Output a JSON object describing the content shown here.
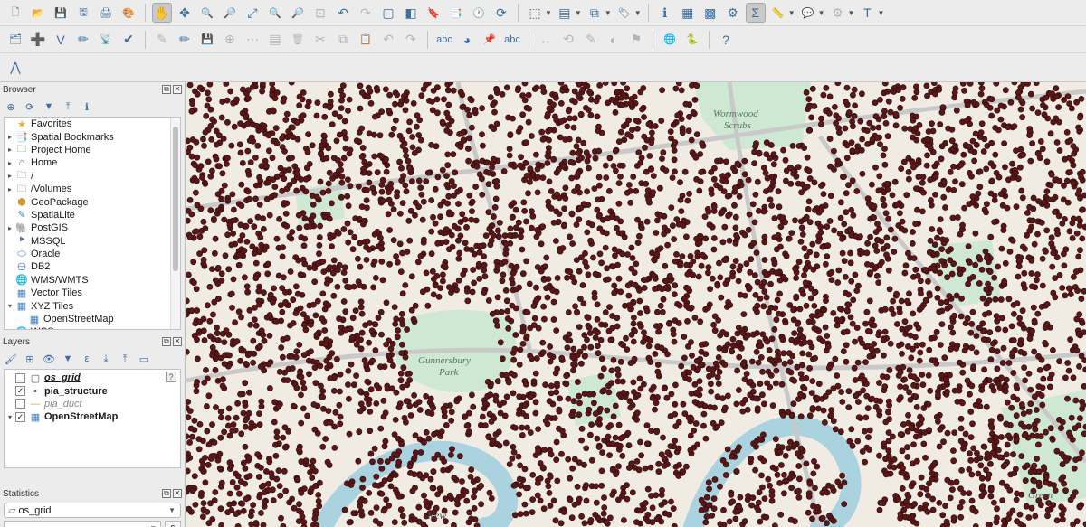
{
  "toolbar_row1": [
    {
      "icon": "new-project-icon",
      "glyph": "🗋"
    },
    {
      "icon": "open-project-icon",
      "glyph": "📂"
    },
    {
      "icon": "save-project-icon",
      "glyph": "💾"
    },
    {
      "icon": "save-as-icon",
      "glyph": "🖫"
    },
    {
      "icon": "print-layout-icon",
      "glyph": "🖨"
    },
    {
      "icon": "style-manager-icon",
      "glyph": "🎨"
    },
    {
      "icon": "pan-map-icon",
      "glyph": "✋",
      "active": true
    },
    {
      "icon": "pan-to-selection-icon",
      "glyph": "✥"
    },
    {
      "icon": "zoom-in-icon",
      "glyph": "🔍"
    },
    {
      "icon": "zoom-out-icon",
      "glyph": "🔎"
    },
    {
      "icon": "zoom-full-icon",
      "glyph": "⤢"
    },
    {
      "icon": "zoom-selection-icon",
      "glyph": "🔍"
    },
    {
      "icon": "zoom-layer-icon",
      "glyph": "🔎"
    },
    {
      "icon": "zoom-native-icon",
      "glyph": "⊡",
      "disabled": true
    },
    {
      "icon": "zoom-last-icon",
      "glyph": "↶"
    },
    {
      "icon": "zoom-next-icon",
      "glyph": "↷",
      "disabled": true
    },
    {
      "icon": "new-map-view-icon",
      "glyph": "▢"
    },
    {
      "icon": "new-3d-view-icon",
      "glyph": "◧"
    },
    {
      "icon": "spatial-bookmark-icon",
      "glyph": "🔖"
    },
    {
      "icon": "show-bookmarks-icon",
      "glyph": "📑"
    },
    {
      "icon": "temporal-controller-icon",
      "glyph": "🕐"
    },
    {
      "icon": "refresh-icon",
      "glyph": "⟳"
    },
    {
      "icon": "select-features-icon",
      "glyph": "⬚",
      "caret": true
    },
    {
      "icon": "select-by-value-icon",
      "glyph": "▤",
      "caret": true
    },
    {
      "icon": "deselect-icon",
      "glyph": "⧉",
      "caret": true
    },
    {
      "icon": "label-icon",
      "glyph": "🏷",
      "caret": true
    },
    {
      "icon": "identify-icon",
      "glyph": "ℹ"
    },
    {
      "icon": "attribute-table-icon",
      "glyph": "▦"
    },
    {
      "icon": "field-calculator-icon",
      "glyph": "▩"
    },
    {
      "icon": "settings-gear-icon",
      "glyph": "⚙"
    },
    {
      "icon": "statistics-sigma-icon",
      "glyph": "Σ",
      "active": true
    },
    {
      "icon": "measure-icon",
      "glyph": "📏",
      "caret": true
    },
    {
      "icon": "map-tips-icon",
      "glyph": "💬",
      "caret": true
    },
    {
      "icon": "locator-icon",
      "glyph": "⚙",
      "caret": true,
      "disabled": true
    },
    {
      "icon": "text-annotation-icon",
      "glyph": "T",
      "caret": true
    }
  ],
  "toolbar_row2": [
    {
      "icon": "data-source-manager-icon",
      "glyph": "🗂"
    },
    {
      "icon": "new-layer-icon",
      "glyph": "➕"
    },
    {
      "icon": "add-vector-icon",
      "glyph": "V"
    },
    {
      "icon": "digitize-icon",
      "glyph": "✏"
    },
    {
      "icon": "gps-icon",
      "glyph": "📡"
    },
    {
      "icon": "validate-icon",
      "glyph": "✔"
    },
    {
      "icon": "current-edits-icon",
      "glyph": "✎",
      "disabled": true
    },
    {
      "icon": "toggle-editing-icon",
      "glyph": "✏"
    },
    {
      "icon": "save-edits-icon",
      "glyph": "💾",
      "disabled": true
    },
    {
      "icon": "add-feature-icon",
      "glyph": "⊕",
      "disabled": true
    },
    {
      "icon": "vertex-tool-icon",
      "glyph": "⋯",
      "disabled": true
    },
    {
      "icon": "modify-attributes-icon",
      "glyph": "▤",
      "disabled": true
    },
    {
      "icon": "delete-selected-icon",
      "glyph": "🗑",
      "disabled": true
    },
    {
      "icon": "cut-features-icon",
      "glyph": "✂",
      "disabled": true
    },
    {
      "icon": "copy-features-icon",
      "glyph": "⧉",
      "disabled": true
    },
    {
      "icon": "paste-features-icon",
      "glyph": "📋",
      "disabled": true
    },
    {
      "icon": "undo-icon",
      "glyph": "↶",
      "disabled": true
    },
    {
      "icon": "redo-icon",
      "glyph": "↷",
      "disabled": true
    },
    {
      "icon": "label-toolbar-icon",
      "glyph": "abc"
    },
    {
      "icon": "diagram-icon",
      "glyph": "◕"
    },
    {
      "icon": "pin-label-icon",
      "glyph": "📌"
    },
    {
      "icon": "highlight-label-icon",
      "glyph": "abc"
    },
    {
      "icon": "move-label-icon",
      "glyph": "↔",
      "disabled": true
    },
    {
      "icon": "rotate-label-icon",
      "glyph": "⟲",
      "disabled": true
    },
    {
      "icon": "change-label-icon",
      "glyph": "✎",
      "disabled": true
    },
    {
      "icon": "show-hide-label-icon",
      "glyph": "◐",
      "disabled": true
    },
    {
      "icon": "label-props-icon",
      "glyph": "⚑",
      "disabled": true
    },
    {
      "icon": "plugin-icon",
      "glyph": "🌐"
    },
    {
      "icon": "python-console-icon",
      "glyph": "🐍"
    },
    {
      "icon": "help-book-icon",
      "glyph": "?"
    }
  ],
  "toolbar_row3": [
    {
      "icon": "plugin-logo-icon",
      "glyph": "⋀"
    }
  ],
  "browser": {
    "title": "Browser",
    "toolbar": [
      {
        "icon": "add-selected-layers-icon",
        "glyph": "⊕"
      },
      {
        "icon": "refresh-browser-icon",
        "glyph": "⟳"
      },
      {
        "icon": "filter-browser-icon",
        "glyph": "▼"
      },
      {
        "icon": "collapse-all-icon",
        "glyph": "⤒"
      },
      {
        "icon": "enable-properties-icon",
        "glyph": "ℹ"
      }
    ],
    "items": [
      {
        "label": "Favorites",
        "icon": "star-icon",
        "glyph": "★",
        "color": "#e3b23c",
        "arrow": "",
        "indent": 0
      },
      {
        "label": "Spatial Bookmarks",
        "icon": "bookmarks-icon",
        "glyph": "📑",
        "color": "#6b8eb5",
        "arrow": "▸",
        "indent": 0
      },
      {
        "label": "Project Home",
        "icon": "project-home-icon",
        "glyph": "🗀",
        "color": "#4f8f3a",
        "arrow": "▸",
        "indent": 0
      },
      {
        "label": "Home",
        "icon": "home-icon",
        "glyph": "⌂",
        "color": "#555555",
        "arrow": "▸",
        "indent": 0
      },
      {
        "label": "/",
        "icon": "folder-icon",
        "glyph": "🗀",
        "color": "#7a7a7a",
        "arrow": "▸",
        "indent": 0
      },
      {
        "label": "/Volumes",
        "icon": "folder-icon",
        "glyph": "🗀",
        "color": "#7a7a7a",
        "arrow": "▸",
        "indent": 0
      },
      {
        "label": "GeoPackage",
        "icon": "geopackage-icon",
        "glyph": "⬢",
        "color": "#d39a2c",
        "arrow": "",
        "indent": 0
      },
      {
        "label": "SpatiaLite",
        "icon": "spatialite-icon",
        "glyph": "✎",
        "color": "#3d7fc2",
        "arrow": "",
        "indent": 0
      },
      {
        "label": "PostGIS",
        "icon": "postgis-elephant-icon",
        "glyph": "🐘",
        "color": "#336791",
        "arrow": "▸",
        "indent": 0
      },
      {
        "label": "MSSQL",
        "icon": "mssql-icon",
        "glyph": "⯈",
        "color": "#5a6f9a",
        "arrow": "",
        "indent": 0
      },
      {
        "label": "Oracle",
        "icon": "oracle-icon",
        "glyph": "⬭",
        "color": "#3b6fb5",
        "arrow": "",
        "indent": 0
      },
      {
        "label": "DB2",
        "icon": "db2-icon",
        "glyph": "⛁",
        "color": "#3b6fb5",
        "arrow": "",
        "indent": 0
      },
      {
        "label": "WMS/WMTS",
        "icon": "wms-globe-icon",
        "glyph": "🌐",
        "color": "#3d7fc2",
        "arrow": "",
        "indent": 0
      },
      {
        "label": "Vector Tiles",
        "icon": "vector-tiles-icon",
        "glyph": "▦",
        "color": "#3d7fc2",
        "arrow": "",
        "indent": 0
      },
      {
        "label": "XYZ Tiles",
        "icon": "xyz-tiles-icon",
        "glyph": "▦",
        "color": "#3d7fc2",
        "arrow": "▾",
        "indent": 0
      },
      {
        "label": "OpenStreetMap",
        "icon": "xyz-tile-layer-icon",
        "glyph": "▦",
        "color": "#3d7fc2",
        "arrow": "",
        "indent": 1
      },
      {
        "label": "WCS",
        "icon": "wcs-globe-icon",
        "glyph": "🌐",
        "color": "#3d7fc2",
        "arrow": "",
        "indent": 0
      }
    ]
  },
  "layers": {
    "title": "Layers",
    "toolbar": [
      {
        "icon": "open-layer-styling-icon",
        "glyph": "🖌"
      },
      {
        "icon": "add-group-icon",
        "glyph": "⊞"
      },
      {
        "icon": "manage-visibility-icon",
        "glyph": "👁"
      },
      {
        "icon": "filter-legend-icon",
        "glyph": "▼"
      },
      {
        "icon": "filter-expression-icon",
        "glyph": "ε"
      },
      {
        "icon": "expand-all-icon",
        "glyph": "⤓"
      },
      {
        "icon": "collapse-all-layers-icon",
        "glyph": "⤒"
      },
      {
        "icon": "remove-layer-icon",
        "glyph": "▭"
      }
    ],
    "help_badge": "?",
    "items": [
      {
        "label": "os_grid",
        "checked": false,
        "checkmark": "",
        "bold": true,
        "italic": true,
        "underline": true,
        "muted": false,
        "symbol": "polygon-symbol-icon",
        "symbol_glyph": "▢",
        "arrow": "",
        "indent": 1
      },
      {
        "label": "pia_structure",
        "checked": true,
        "checkmark": "✓",
        "bold": true,
        "italic": false,
        "underline": false,
        "muted": false,
        "symbol": "point-symbol-icon",
        "symbol_glyph": "•",
        "arrow": "",
        "indent": 1
      },
      {
        "label": "pia_duct",
        "checked": false,
        "checkmark": "",
        "bold": false,
        "italic": true,
        "underline": false,
        "muted": true,
        "symbol": "line-symbol-icon",
        "symbol_glyph": "—",
        "arrow": "",
        "indent": 1
      },
      {
        "label": "OpenStreetMap",
        "checked": true,
        "checkmark": "✓",
        "bold": true,
        "italic": false,
        "underline": false,
        "muted": false,
        "symbol": "raster-layer-icon",
        "symbol_glyph": "▦",
        "arrow": "▾",
        "indent": 0
      }
    ]
  },
  "statistics": {
    "title": "Statistics",
    "layer_select_value": "os_grid",
    "layer_icon_glyph": "▱",
    "field_value": "",
    "expression_button": "ε"
  },
  "map": {
    "labels": [
      {
        "text": "Wormwood",
        "id": "label-wormwood"
      },
      {
        "text": "Scrubs",
        "id": "label-scrubs"
      },
      {
        "text": "Gunnersbury",
        "id": "label-gunnersbury"
      },
      {
        "text": "Park",
        "id": "label-park"
      },
      {
        "text": "Kew",
        "id": "label-kew"
      },
      {
        "text": "Green",
        "id": "label-green"
      }
    ],
    "colors": {
      "base": "#f1ece3",
      "park": "#cfe8d4",
      "water": "#aad3df",
      "road": "#c9c9c9",
      "structure_fill": "#5b1718",
      "structure_stroke": "#2c0b0b"
    }
  },
  "dock_controls": {
    "float": "⧉",
    "close": "✕"
  }
}
